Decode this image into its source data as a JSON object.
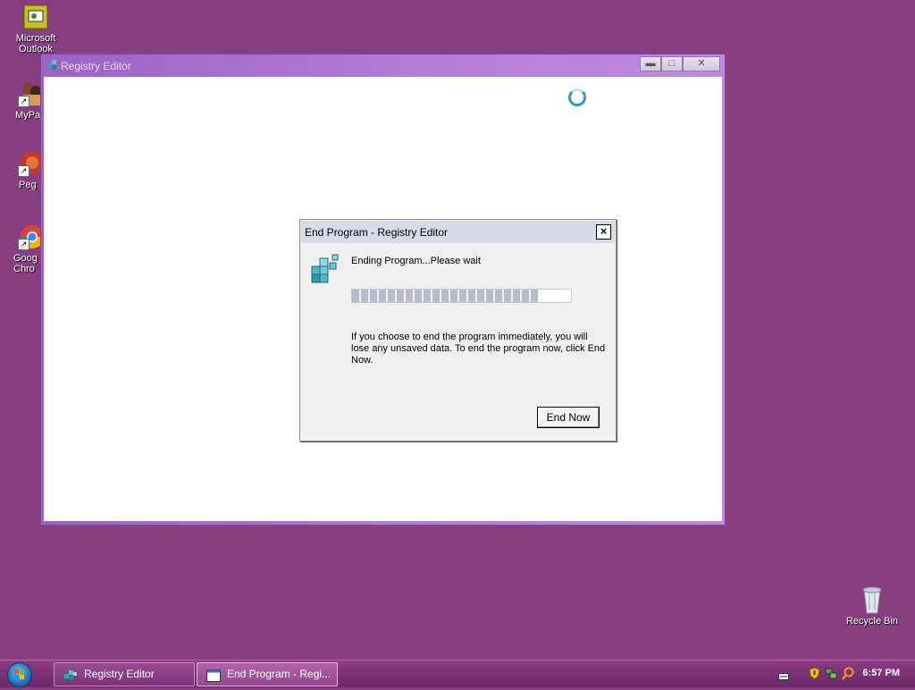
{
  "desktop": {
    "icons": [
      {
        "label": "Microsoft Outlook"
      },
      {
        "label": "MyPa"
      },
      {
        "label": "Peg"
      },
      {
        "label": "Goog Chro"
      },
      {
        "label": "Recycle Bin"
      }
    ]
  },
  "registry_window": {
    "title": "Registry Editor",
    "controls": {
      "minimize": "▬",
      "maximize": "□",
      "close": "✕"
    }
  },
  "dialog": {
    "title": "End Program - Registry Editor",
    "close_glyph": "×",
    "message": "Ending Program...Please wait",
    "progress": 0.85,
    "warning": "If you choose to end the program immediately, you will lose any unsaved data. To end the program now, click End Now.",
    "end_now_label": "End Now"
  },
  "taskbar": {
    "buttons": [
      {
        "label": "Registry Editor"
      },
      {
        "label": "End Program - Regi..."
      }
    ],
    "clock": "6:57 PM"
  },
  "colors": {
    "desktop": "#873f82",
    "taskbar": "#7a3277",
    "window_title": "#b27ad6",
    "dialog_title": "#d9dae8"
  }
}
